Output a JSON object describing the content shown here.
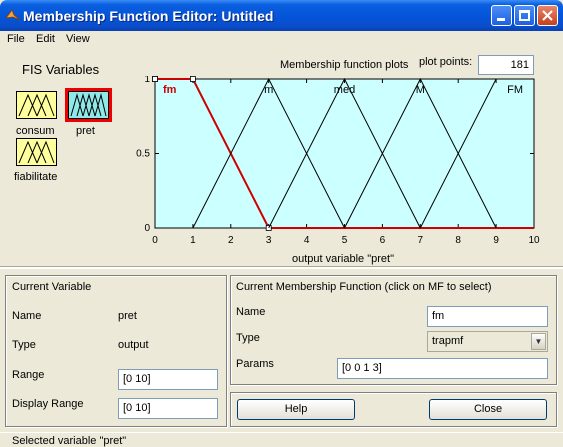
{
  "window": {
    "title": "Membership Function Editor: Untitled"
  },
  "menu": [
    "File",
    "Edit",
    "View"
  ],
  "fis_variables": {
    "heading": "FIS Variables",
    "inputs": [
      {
        "label": "consum"
      },
      {
        "label": "fiabilitate"
      }
    ],
    "output": {
      "label": "pret",
      "selected": true
    }
  },
  "plot_header": {
    "title": "Membership function plots",
    "plot_points_label": "plot points:",
    "plot_points_value": "181"
  },
  "chart_data": {
    "type": "line",
    "xlabel": "output variable \"pret\"",
    "xlim": [
      0,
      10
    ],
    "ylim": [
      0,
      1
    ],
    "xticks": [
      "0",
      "1",
      "2",
      "3",
      "4",
      "5",
      "6",
      "7",
      "8",
      "9",
      "10"
    ],
    "yticks": [
      "0",
      "0.5",
      "1"
    ],
    "background": "#ccffff",
    "series": [
      {
        "name": "fm",
        "type": "trapmf",
        "x": [
          0,
          0,
          1,
          3
        ],
        "y": [
          1,
          1,
          1,
          0
        ],
        "color": "#cc0000",
        "selected": true
      },
      {
        "name": "m",
        "type": "trimf",
        "x": [
          1,
          3,
          5
        ],
        "y": [
          0,
          1,
          0
        ],
        "color": "#000000"
      },
      {
        "name": "med",
        "type": "trimf",
        "x": [
          3,
          5,
          7
        ],
        "y": [
          0,
          1,
          0
        ],
        "color": "#000000"
      },
      {
        "name": "M",
        "type": "trimf",
        "x": [
          5,
          7,
          9
        ],
        "y": [
          0,
          1,
          0
        ],
        "color": "#000000"
      },
      {
        "name": "FM",
        "type": "trapmf",
        "x": [
          7,
          9,
          10,
          10
        ],
        "y": [
          0,
          1,
          1,
          1
        ],
        "color": "#000000"
      }
    ]
  },
  "current_variable": {
    "heading": "Current Variable",
    "name_label": "Name",
    "name_value": "pret",
    "type_label": "Type",
    "type_value": "output",
    "range_label": "Range",
    "range_value": "[0 10]",
    "display_range_label": "Display Range",
    "display_range_value": "[0 10]"
  },
  "current_mf": {
    "heading": "Current Membership Function (click on MF to select)",
    "name_label": "Name",
    "name_value": "fm",
    "type_label": "Type",
    "type_value": "trapmf",
    "params_label": "Params",
    "params_value": "[0 0 1 3]"
  },
  "buttons": {
    "help": "Help",
    "close": "Close"
  },
  "status": "Selected variable \"pret\""
}
